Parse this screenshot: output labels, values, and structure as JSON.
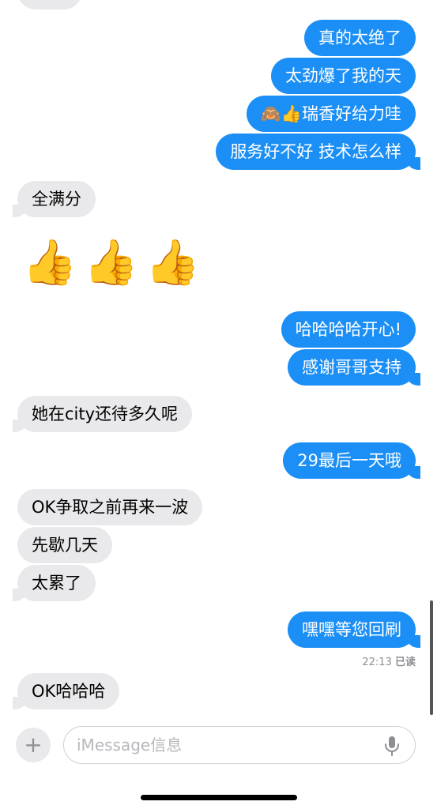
{
  "messages": [
    {
      "side": "sent",
      "text": "真的太绝了"
    },
    {
      "side": "sent",
      "text": "太劲爆了我的天"
    },
    {
      "side": "sent",
      "text": "🙈👍瑞香好给力哇"
    },
    {
      "side": "sent",
      "text": "服务好不好 技术怎么样"
    },
    {
      "side": "recv",
      "text": "全满分"
    },
    {
      "side": "recv",
      "text": "👍👍👍"
    },
    {
      "side": "sent",
      "text": "哈哈哈哈开心!"
    },
    {
      "side": "sent",
      "text": "感谢哥哥支持"
    },
    {
      "side": "recv",
      "text": "她在city还待多久呢"
    },
    {
      "side": "sent",
      "text": "29最后一天哦"
    },
    {
      "side": "recv",
      "text": "OK争取之前再来一波"
    },
    {
      "side": "recv",
      "text": "先歇几天"
    },
    {
      "side": "recv",
      "text": "太累了"
    },
    {
      "side": "sent",
      "text": "嘿嘿等您回刷"
    },
    {
      "side": "recv",
      "text": "OK哈哈哈"
    }
  ],
  "receipt": {
    "time": "22:13",
    "status": "已读"
  },
  "composer": {
    "placeholder": "iMessage信息",
    "plus_icon": "plus-icon",
    "mic_icon": "microphone-icon"
  },
  "colors": {
    "sent_bubble": "#1b8ff5",
    "recv_bubble": "#e9e9eb",
    "background": "#ffffff"
  }
}
